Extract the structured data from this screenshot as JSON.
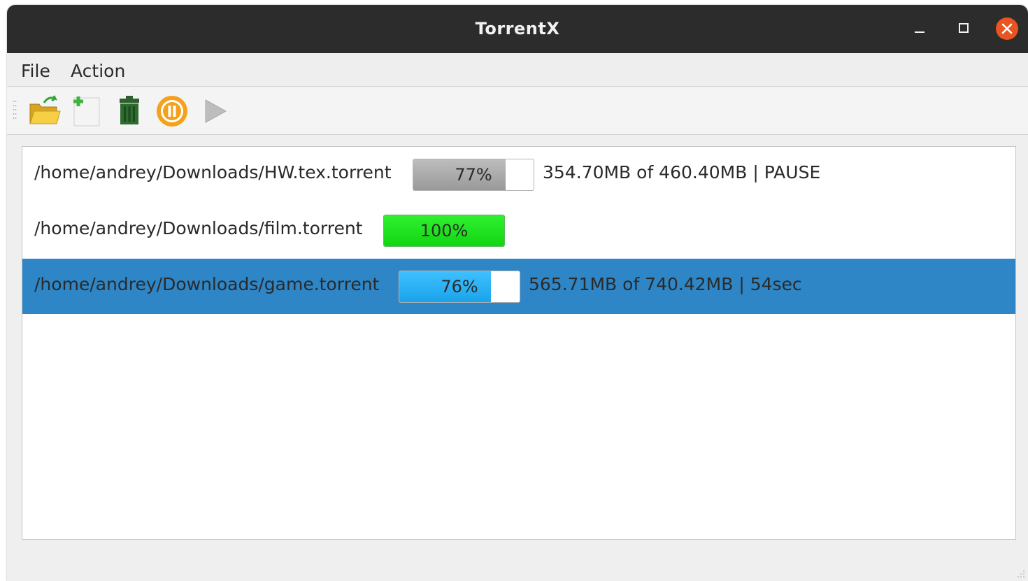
{
  "window": {
    "title": "TorrentX"
  },
  "menu": {
    "items": [
      "File",
      "Action"
    ]
  },
  "toolbar": {
    "buttons": [
      {
        "icon": "open-folder-icon"
      },
      {
        "icon": "new-file-icon"
      },
      {
        "icon": "trash-icon"
      },
      {
        "icon": "pause-icon"
      },
      {
        "icon": "play-icon"
      }
    ]
  },
  "colors": {
    "titlebar": "#2c2c2c",
    "close": "#e95420",
    "bar_paused": "#a9a9a9",
    "bar_complete": "#19e619",
    "bar_active": "#2ab0f2",
    "selection": "#2f86c6"
  },
  "torrents": [
    {
      "path": "/home/andrey/Downloads/HW.tex.torrent",
      "progress_text": "77%",
      "progress": 0.77,
      "info": "354.70MB of 460.40MB  |  PAUSE",
      "state": "paused",
      "selected": false
    },
    {
      "path": "/home/andrey/Downloads/film.torrent",
      "progress_text": "100%",
      "progress": 1.0,
      "info": "",
      "state": "complete",
      "selected": false
    },
    {
      "path": "/home/andrey/Downloads/game.torrent",
      "progress_text": "76%",
      "progress": 0.76,
      "info": "565.71MB of 740.42MB  |  54sec",
      "state": "active",
      "selected": true
    }
  ]
}
